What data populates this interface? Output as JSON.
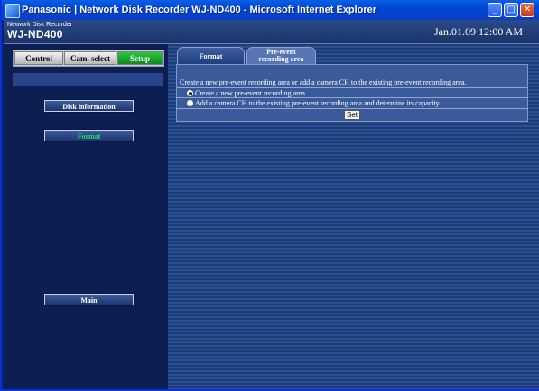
{
  "window": {
    "title": "Panasonic | Network Disk Recorder WJ-ND400 - Microsoft Internet Explorer",
    "controls": {
      "minimize": "_",
      "maximize": "□",
      "close": "✕"
    }
  },
  "header": {
    "subtitle": "Network Disk Recorder",
    "model": "WJ-ND400",
    "datetime": "Jan.01.09  12:00  AM"
  },
  "main_tabs": [
    {
      "label": "Control"
    },
    {
      "label": "Cam. select"
    },
    {
      "label": "Setup"
    }
  ],
  "side_buttons": {
    "disk_information": "Disk information",
    "format": "Format",
    "main": "Main"
  },
  "content_tabs": {
    "format": "Format",
    "pre_event_line1": "Pre-event",
    "pre_event_line2": "recording area"
  },
  "panel": {
    "instruction": "Create a new pre-event recording area or add a camera CH to the existing pre-event recording area.",
    "options": [
      {
        "label": "Create a new pre-event recording area",
        "selected": true
      },
      {
        "label": "Add a camera CH to the existing pre-event recording area and determine its capacity",
        "selected": false
      }
    ],
    "set_button": "Set"
  },
  "colors": {
    "titlebar": "#0046d5",
    "header": "#1b3468",
    "sidebar": "#0d1f52",
    "setup_active": "#1ba32e",
    "format_active_text": "#22e06a",
    "content_panel": "#3a5a9a"
  }
}
